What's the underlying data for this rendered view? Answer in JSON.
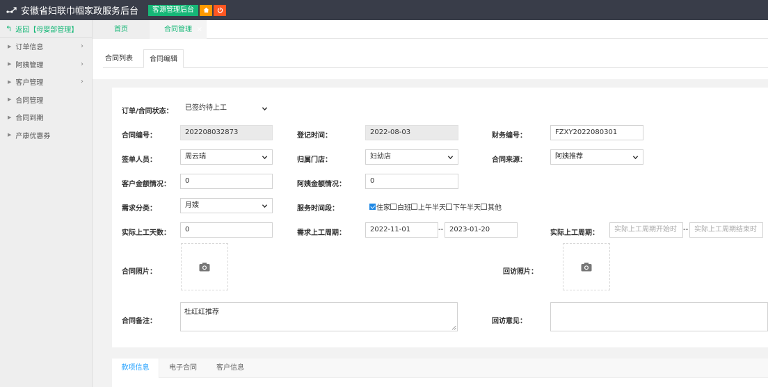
{
  "app": {
    "title": "安徽省妇联巾帼家政服务后台",
    "module_button": "客源管理后台",
    "home_icon": "home-icon",
    "exit_icon": "power-icon",
    "colors": {
      "topbar": "#393d49",
      "accent": "#16b777",
      "orange": "#ff9900",
      "red": "#ff5722",
      "link_blue": "#1e9fff"
    }
  },
  "sidebar": {
    "back_label": "返回【母婴部管理】",
    "items": [
      {
        "label": "订单信息",
        "has_children": true
      },
      {
        "label": "阿姨管理",
        "has_children": true
      },
      {
        "label": "客户管理",
        "has_children": true
      },
      {
        "label": "合同管理",
        "has_children": false
      },
      {
        "label": "合同到期",
        "has_children": false
      },
      {
        "label": "产康优惠券",
        "has_children": false
      }
    ]
  },
  "tabs": {
    "home": "首页",
    "contract": "合同管理",
    "close_glyph": "×"
  },
  "subtabs": {
    "list": "合同列表",
    "edit": "合同编辑"
  },
  "form": {
    "status": {
      "label": "订单/合同状态：",
      "value": "已签约待上工"
    },
    "contract_no": {
      "label": "合同编号：",
      "value": "202208032873"
    },
    "register_time": {
      "label": "登记时间：",
      "value": "2022-08-03"
    },
    "finance_no": {
      "label": "财务编号：",
      "value": "FZXY2022080301"
    },
    "signer": {
      "label": "签单人员：",
      "value": "周云瑞"
    },
    "store": {
      "label": "归属门店：",
      "value": "妇幼店"
    },
    "source": {
      "label": "合同来源：",
      "value": "阿姨推荐"
    },
    "customer_amount": {
      "label": "客户金额情况：",
      "value": "0"
    },
    "nanny_amount": {
      "label": "阿姨金额情况：",
      "value": "0"
    },
    "demand_type": {
      "label": "需求分类：",
      "value": "月嫂"
    },
    "service_period": {
      "label": "服务时间段：",
      "options": [
        {
          "label": "住家",
          "checked": true
        },
        {
          "label": "白班",
          "checked": false
        },
        {
          "label": "上午半天",
          "checked": false
        },
        {
          "label": "下午半天",
          "checked": false
        },
        {
          "label": "其他",
          "checked": false
        }
      ]
    },
    "actual_days": {
      "label": "实际上工天数：",
      "value": "0"
    },
    "demand_period": {
      "label": "需求上工周期：",
      "start": "2022-11-01",
      "end": "2023-01-20",
      "sep": "--"
    },
    "actual_period": {
      "label": "实际上工周期：",
      "start_placeholder": "实际上工周期开始时",
      "end_placeholder": "实际上工周期结束时",
      "sep": "--"
    },
    "contract_photo": {
      "label": "合同照片："
    },
    "visit_photo": {
      "label": "回访照片："
    },
    "remark": {
      "label": "合同备注：",
      "value": "杜红红推荐"
    },
    "visit_opinion": {
      "label": "回访意见：",
      "value": ""
    }
  },
  "bottom_tabs": [
    "款项信息",
    "电子合同",
    "客户信息"
  ]
}
